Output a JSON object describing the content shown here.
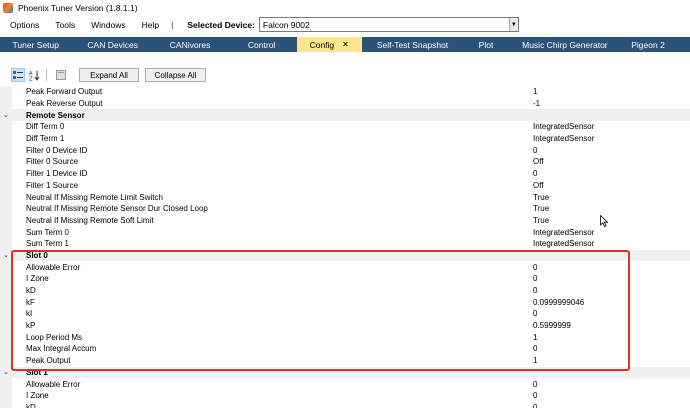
{
  "window": {
    "title": "Phoenix Tuner Version (1.8.1.1)"
  },
  "menu": {
    "items": [
      "Options",
      "Tools",
      "Windows",
      "Help"
    ],
    "separator": "|",
    "selected_device_label": "Selected Device:",
    "selected_device_value": "Falcon 9002"
  },
  "tabs": [
    {
      "label": "Tuner Setup"
    },
    {
      "label": "CAN Devices"
    },
    {
      "label": "CANivores"
    },
    {
      "label": "Control"
    },
    {
      "label": "Config",
      "active": true,
      "close": "✕"
    },
    {
      "label": "Self-Test Snapshot"
    },
    {
      "label": "Plot"
    },
    {
      "label": "Music Chirp Generator"
    },
    {
      "label": "Pigeon 2"
    }
  ],
  "toolbar": {
    "expand_all": "Expand All",
    "collapse_all": "Collapse All"
  },
  "grid": {
    "rows": [
      {
        "type": "prop",
        "name": "Peak Forward Output",
        "value": "1"
      },
      {
        "type": "prop",
        "name": "Peak Reverse Output",
        "value": "-1"
      },
      {
        "type": "cat",
        "name": "Remote Sensor"
      },
      {
        "type": "prop",
        "name": "Diff Term 0",
        "value": "IntegratedSensor"
      },
      {
        "type": "prop",
        "name": "Diff Term 1",
        "value": "IntegratedSensor"
      },
      {
        "type": "prop",
        "name": "Filter 0 Device ID",
        "value": "0"
      },
      {
        "type": "prop",
        "name": "Filter 0 Source",
        "value": "Off"
      },
      {
        "type": "prop",
        "name": "Filter 1 Device ID",
        "value": "0"
      },
      {
        "type": "prop",
        "name": "Filter 1 Source",
        "value": "Off"
      },
      {
        "type": "prop",
        "name": "Neutral If Missing Remote Limit Switch",
        "value": "True"
      },
      {
        "type": "prop",
        "name": "Neutral If Missing Remote Sensor Dur Closed Loop",
        "value": "True"
      },
      {
        "type": "prop",
        "name": "Neutral If Missing Remote Soft Limit",
        "value": "True"
      },
      {
        "type": "prop",
        "name": "Sum Term 0",
        "value": "IntegratedSensor"
      },
      {
        "type": "prop",
        "name": "Sum Term 1",
        "value": "IntegratedSensor"
      },
      {
        "type": "cat",
        "name": "Slot 0"
      },
      {
        "type": "prop",
        "name": "Allowable Error",
        "value": "0"
      },
      {
        "type": "prop",
        "name": "I Zone",
        "value": "0"
      },
      {
        "type": "prop",
        "name": "kD",
        "value": "0"
      },
      {
        "type": "prop",
        "name": "kF",
        "value": "0.0999999046"
      },
      {
        "type": "prop",
        "name": "kI",
        "value": "0"
      },
      {
        "type": "prop",
        "name": "kP",
        "value": "0.5999999"
      },
      {
        "type": "prop",
        "name": "Loop Period Ms",
        "value": "1"
      },
      {
        "type": "prop",
        "name": "Max Integral Accum",
        "value": "0"
      },
      {
        "type": "prop",
        "name": "Peak Output",
        "value": "1"
      },
      {
        "type": "cat",
        "name": "Slot 1"
      },
      {
        "type": "prop",
        "name": "Allowable Error",
        "value": "0"
      },
      {
        "type": "prop",
        "name": "I Zone",
        "value": "0"
      },
      {
        "type": "prop",
        "name": "kD",
        "value": "0"
      }
    ]
  },
  "colors": {
    "tabbar_bg": "#2b5278",
    "active_tab_bg": "#ffe58c",
    "highlight_border": "#d9322e"
  }
}
